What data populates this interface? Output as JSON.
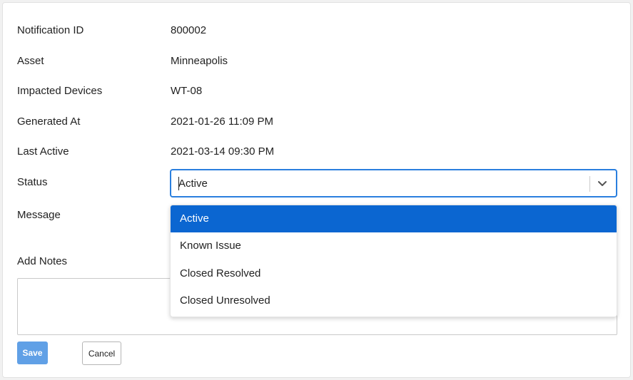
{
  "fields": [
    {
      "label": "Notification ID",
      "value": "800002"
    },
    {
      "label": "Asset",
      "value": "Minneapolis"
    },
    {
      "label": "Impacted Devices",
      "value": "WT-08"
    },
    {
      "label": "Generated At",
      "value": "2021-01-26 11:09 PM"
    },
    {
      "label": "Last Active",
      "value": "2021-03-14 09:30 PM"
    }
  ],
  "status": {
    "label": "Status",
    "selected": "Active",
    "icon": "chevron-down-icon",
    "options": [
      "Active",
      "Known Issue",
      "Closed Resolved",
      "Closed Unresolved"
    ]
  },
  "message": {
    "label": "Message"
  },
  "notes": {
    "label": "Add Notes",
    "value": ""
  },
  "buttons": {
    "save": "Save",
    "cancel": "Cancel"
  },
  "colors": {
    "accent": "#2a7fde",
    "option_selected_bg": "#0b66d1",
    "save_button_bg": "#60a0e6"
  }
}
